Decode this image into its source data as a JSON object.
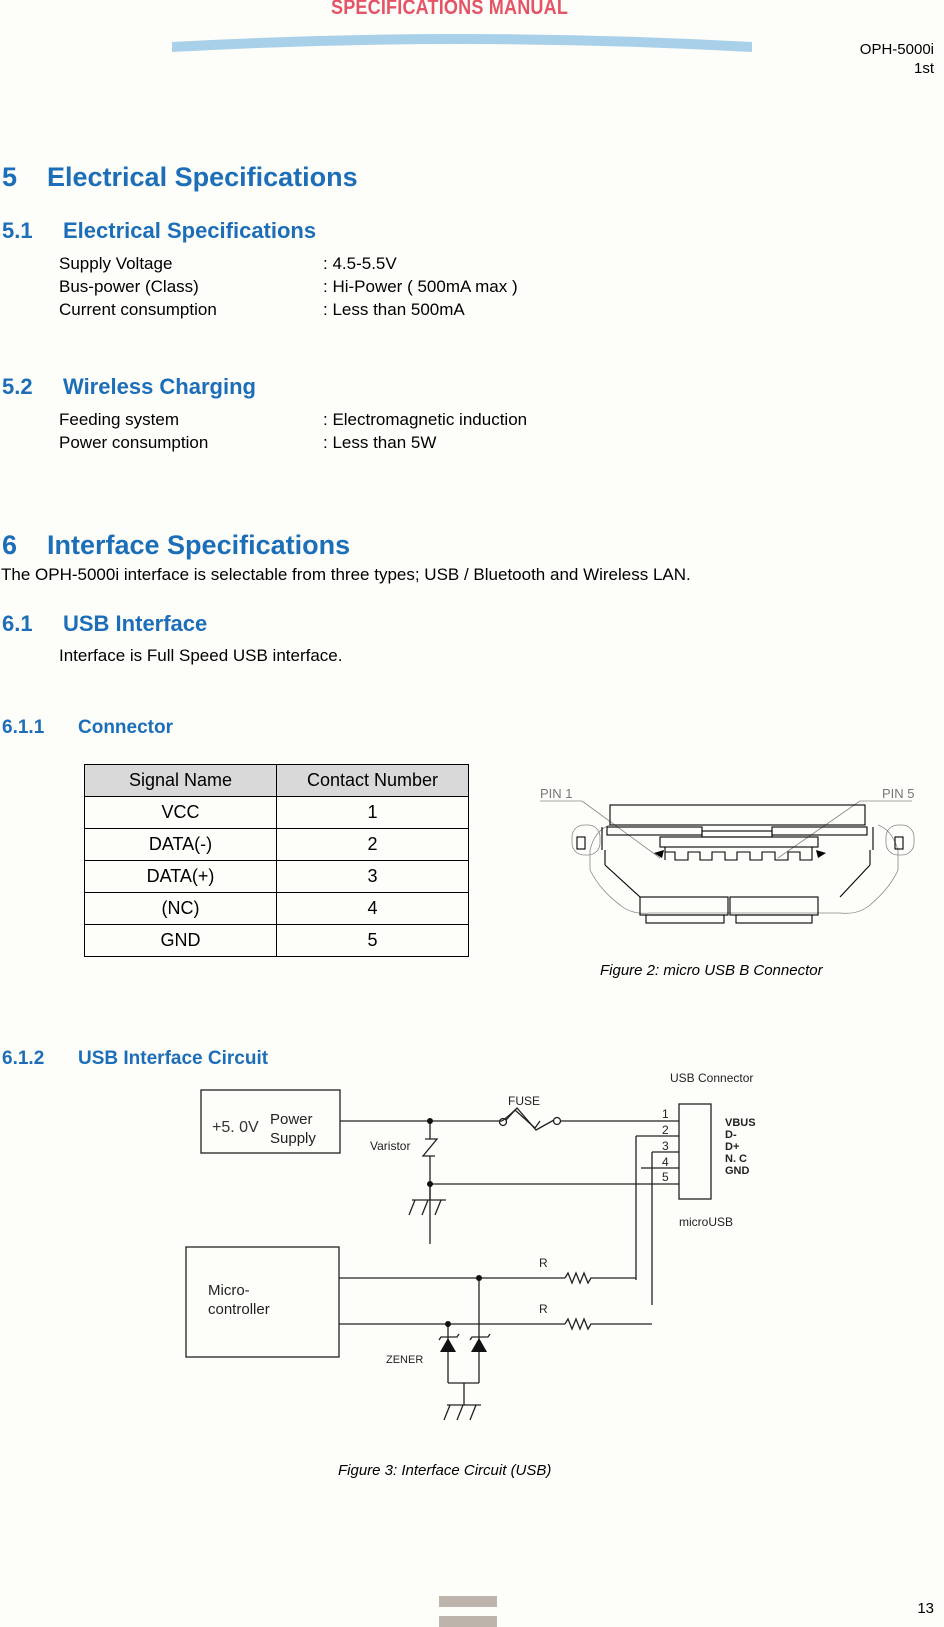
{
  "header": {
    "banner_title": "SPECIFICATIONS MANUAL",
    "model": "OPH-5000i",
    "edition": "1st",
    "colors": {
      "banner_title": "#e45466",
      "banner_bar": "#a9d0e9",
      "heading": "#1d6eb8"
    }
  },
  "section5": {
    "number": "5",
    "title": "Electrical Specifications",
    "sub1": {
      "number": "5.1",
      "title": "Electrical Specifications",
      "rows": [
        {
          "label": "Supply Voltage",
          "value": ": 4.5-5.5V"
        },
        {
          "label": "Bus-power (Class)",
          "value": ": Hi-Power ( 500mA max )"
        },
        {
          "label": "Current consumption",
          "value": ": Less than 500mA"
        }
      ]
    },
    "sub2": {
      "number": "5.2",
      "title": "Wireless Charging",
      "rows": [
        {
          "label": "Feeding system",
          "value": ": Electromagnetic induction"
        },
        {
          "label": "Power consumption",
          "value": ": Less than 5W"
        }
      ]
    }
  },
  "section6": {
    "number": "6",
    "title": "Interface Specifications",
    "intro": "The OPH-5000i interface is selectable from three types; USB / Bluetooth and Wireless LAN.",
    "sub1": {
      "number": "6.1",
      "title": "USB Interface",
      "text": "Interface is Full Speed USB interface."
    },
    "connector": {
      "number": "6.1.1",
      "title": "Connector",
      "table": {
        "headers": [
          "Signal Name",
          "Contact Number"
        ],
        "rows": [
          [
            "VCC",
            "1"
          ],
          [
            "DATA(-)",
            "2"
          ],
          [
            "DATA(+)",
            "3"
          ],
          [
            "(NC)",
            "4"
          ],
          [
            "GND",
            "5"
          ]
        ]
      },
      "figure": {
        "pin_left": "PIN 1",
        "pin_right": "PIN 5",
        "caption": "Figure 2: micro USB B Connector"
      }
    },
    "circuit": {
      "number": "6.1.2",
      "title": "USB Interface Circuit",
      "figure": {
        "usb_connector_label": "USB Connector",
        "power_voltage": "+5. 0V",
        "power_label_1": "Power",
        "power_label_2": "Supply",
        "varistor": "Varistor",
        "fuse": "FUSE",
        "pins": [
          "1",
          "2",
          "3",
          "4",
          "5"
        ],
        "signals": [
          "VBUS",
          "D-",
          "D+",
          "N. C",
          "GND"
        ],
        "micro_usb": "microUSB",
        "mcu_label_1": "Micro-",
        "mcu_label_2": "controller",
        "resistor_1": "R",
        "resistor_2": "R",
        "zener": "ZENER",
        "caption": "Figure 3: Interface Circuit (USB)"
      }
    }
  },
  "footer": {
    "page_number": "13"
  }
}
